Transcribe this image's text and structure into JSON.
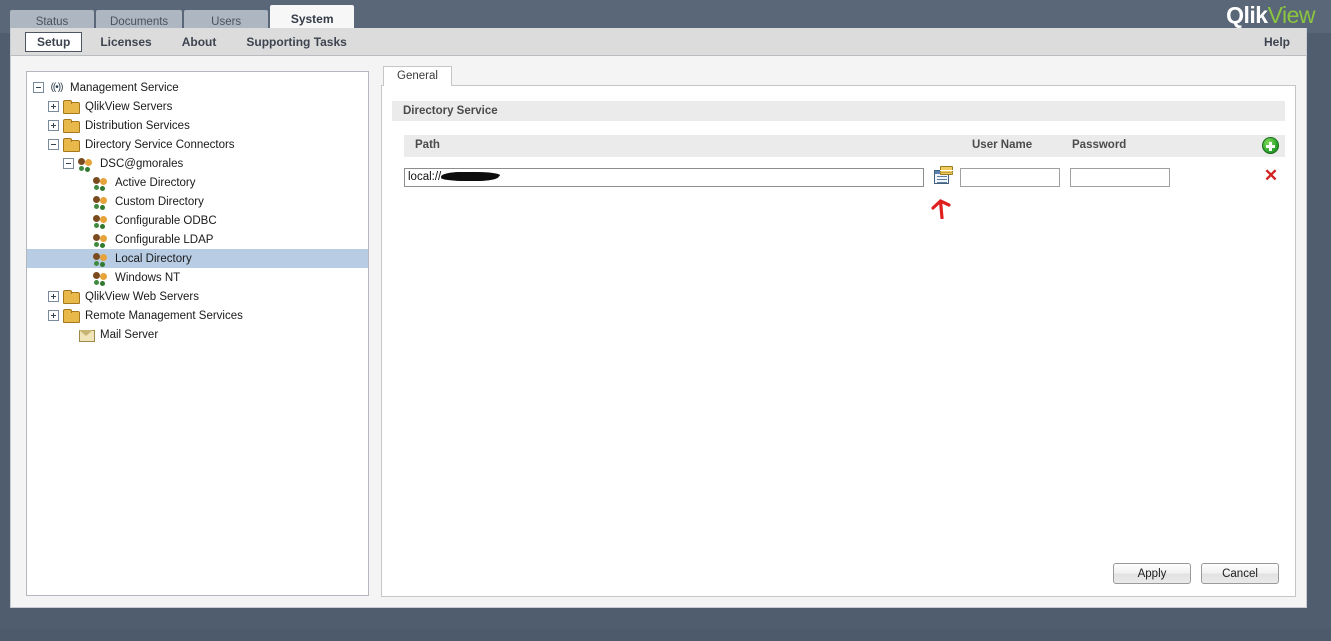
{
  "brand": {
    "logo_primary": "Qlik",
    "logo_secondary": "View",
    "logo_primary_color": "#ffffff",
    "logo_secondary_color": "#8bc53f"
  },
  "main_tabs": [
    {
      "label": "Status",
      "active": false
    },
    {
      "label": "Documents",
      "active": false
    },
    {
      "label": "Users",
      "active": false
    },
    {
      "label": "System",
      "active": true
    }
  ],
  "sub_tabs": [
    {
      "label": "Setup",
      "active": true
    },
    {
      "label": "Licenses",
      "active": false
    },
    {
      "label": "About",
      "active": false
    },
    {
      "label": "Supporting Tasks",
      "active": false
    }
  ],
  "help_label": "Help",
  "tree": {
    "nodes": [
      {
        "label": "Management Service",
        "indent": 0,
        "toggle": "minus",
        "icon": "broadcast-icon",
        "selected": false
      },
      {
        "label": "QlikView Servers",
        "indent": 1,
        "toggle": "plus",
        "icon": "folder-icon",
        "selected": false
      },
      {
        "label": "Distribution Services",
        "indent": 1,
        "toggle": "plus",
        "icon": "folder-icon",
        "selected": false
      },
      {
        "label": "Directory Service Connectors",
        "indent": 1,
        "toggle": "minus",
        "icon": "folder-icon",
        "selected": false
      },
      {
        "label": "DSC@gmorales",
        "indent": 2,
        "toggle": "minus",
        "icon": "users-icon",
        "selected": false
      },
      {
        "label": "Active Directory",
        "indent": 3,
        "toggle": "none",
        "icon": "users-icon",
        "selected": false
      },
      {
        "label": "Custom Directory",
        "indent": 3,
        "toggle": "none",
        "icon": "users-icon",
        "selected": false
      },
      {
        "label": "Configurable ODBC",
        "indent": 3,
        "toggle": "none",
        "icon": "users-icon",
        "selected": false
      },
      {
        "label": "Configurable LDAP",
        "indent": 3,
        "toggle": "none",
        "icon": "users-icon",
        "selected": false
      },
      {
        "label": "Local Directory",
        "indent": 3,
        "toggle": "none",
        "icon": "users-icon",
        "selected": true
      },
      {
        "label": "Windows NT",
        "indent": 3,
        "toggle": "none",
        "icon": "users-icon",
        "selected": false
      },
      {
        "label": "QlikView Web Servers",
        "indent": 1,
        "toggle": "plus",
        "icon": "folder-icon",
        "selected": false
      },
      {
        "label": "Remote Management Services",
        "indent": 1,
        "toggle": "plus",
        "icon": "folder-icon",
        "selected": false
      },
      {
        "label": "Mail Server",
        "indent": 2,
        "toggle": "none",
        "icon": "mail-icon",
        "selected": false
      }
    ]
  },
  "content": {
    "inner_tabs": [
      {
        "label": "General",
        "active": true
      }
    ],
    "section_title": "Directory Service",
    "columns": {
      "path": "Path",
      "user_name": "User Name",
      "password": "Password"
    },
    "row": {
      "path_value": "local://",
      "path_redacted": true,
      "user_name_value": "",
      "password_value": "",
      "browse_icon": "browse-properties-icon",
      "delete_icon": "delete-row-icon",
      "delete_glyph": "✕"
    },
    "add_icon": "add-row-icon",
    "annotation": {
      "type": "arrow",
      "color": "#e02020",
      "points_at": "browse-properties-button"
    }
  },
  "footer": {
    "apply_label": "Apply",
    "cancel_label": "Cancel"
  }
}
